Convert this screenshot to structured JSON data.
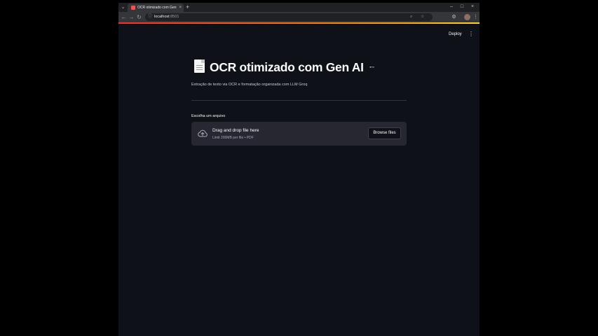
{
  "browser": {
    "tab_title": "OCR otimizado com Gen AI",
    "tab_close": "×",
    "new_tab": "+",
    "url_host": "localhost",
    "url_port": ":8501",
    "window_controls": [
      "–",
      "□",
      "×"
    ],
    "loader_colors": [
      "#ff2b2b",
      "#ff8700",
      "#ffd21f"
    ]
  },
  "app_header": {
    "deploy_label": "Deploy",
    "menu_glyph": "⋮"
  },
  "page": {
    "title": "OCR otimizado com Gen AI",
    "title_icon": "page-facing-up-icon",
    "anchor_glyph": "🔗",
    "subtitle": "Extração de texto via OCR e formatação organizada com LLM Groq",
    "uploader": {
      "label": "Escolha um arquivo",
      "drop_text": "Drag and drop file here",
      "limit_text": "Limit 200MB per file • PDF",
      "browse_label": "Browse files"
    }
  },
  "colors": {
    "app_background": "#0e1117",
    "dropzone_background": "#262730",
    "text": "#fafafa"
  }
}
